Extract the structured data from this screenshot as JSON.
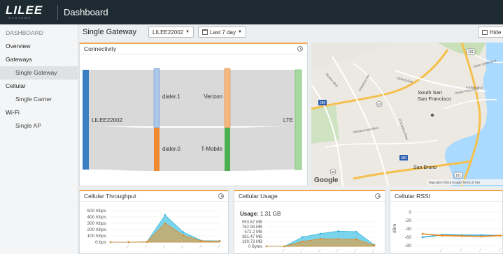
{
  "brand": {
    "logo": "LILEE",
    "logo_sub": "SYSTEMS",
    "app_title": "Dashboard"
  },
  "sidebar": {
    "items": [
      {
        "label": "DASHBOARD"
      },
      {
        "label": "Overview"
      },
      {
        "label": "Gateways"
      },
      {
        "label": "Single Gateway"
      },
      {
        "label": "Cellular"
      },
      {
        "label": "Single Carrier"
      },
      {
        "label": "Wi-Fi"
      },
      {
        "label": "Single AP"
      }
    ]
  },
  "header": {
    "title": "Single Gateway",
    "device_select": "LILEE22002",
    "range_select": "Last 7 day",
    "hide_button": "Hide"
  },
  "connectivity": {
    "title": "Connectivity",
    "source": "LILEE22002",
    "nodes": [
      "dialer.1",
      "Verizon",
      "dialer.0",
      "T-Mobile",
      "LTE"
    ],
    "colors": {
      "source": "#3a7fc1",
      "dialer1": "#aac6e8",
      "verizon": "#f6b77e",
      "dialer0": "#f08a30",
      "tmobile": "#4caf50",
      "lte": "#a6d8a0",
      "flow": "#d9d9d9"
    }
  },
  "map": {
    "places": [
      "San Francisco",
      "South San",
      "San Bruno",
      "Grand Ave",
      "Oyster Point Blvd",
      "Forbes Blvd",
      "Sister Cities Blvd",
      "Chestnut Ave",
      "Westborough Blvd",
      "Skyline Blvd",
      "El Camino Real"
    ],
    "routes": [
      "101",
      "280",
      "82",
      "35",
      "380"
    ],
    "attribution": "Map data ©2018 Google   Terms of Use",
    "google": "Google"
  },
  "throughput": {
    "title": "Cellular Throughput",
    "ticks": [
      "500 Kbps",
      "400 Kbps",
      "300 Kbps",
      "200 Kbps",
      "100 Kbps",
      "0 bps"
    ],
    "chart_data": {
      "type": "area",
      "ylim": [
        0,
        500
      ],
      "series": [
        {
          "values": [
            0,
            0,
            5,
            430,
            160,
            25,
            20
          ]
        },
        {
          "values": [
            0,
            0,
            5,
            300,
            110,
            20,
            15
          ]
        }
      ]
    }
  },
  "usage": {
    "title": "Cellular Usage",
    "usage_label": "Usage:",
    "usage_value": "1.31 GB",
    "ticks": [
      "953.67 MB",
      "762.94 MB",
      "572.2 MB",
      "381.47 MB",
      "190.73 MB",
      "0 Bytes"
    ],
    "chart_data": {
      "type": "area",
      "ylim": [
        0,
        1000
      ],
      "series": [
        {
          "values": [
            0,
            0,
            380,
            520,
            620,
            600,
            60
          ]
        },
        {
          "values": [
            0,
            0,
            200,
            310,
            300,
            290,
            40
          ]
        }
      ]
    }
  },
  "rssi": {
    "title": "Cellular RSSI",
    "ylabel": "dBm",
    "ticks": [
      "0",
      "-20",
      "-40",
      "-60",
      "-80"
    ],
    "chart_data": {
      "type": "line",
      "ylim": [
        -80,
        0
      ],
      "series": [
        {
          "values": [
            -60,
            -54,
            -55,
            -55,
            -56
          ]
        },
        {
          "values": [
            -52,
            -56,
            -57,
            -58,
            -56
          ]
        }
      ]
    }
  }
}
